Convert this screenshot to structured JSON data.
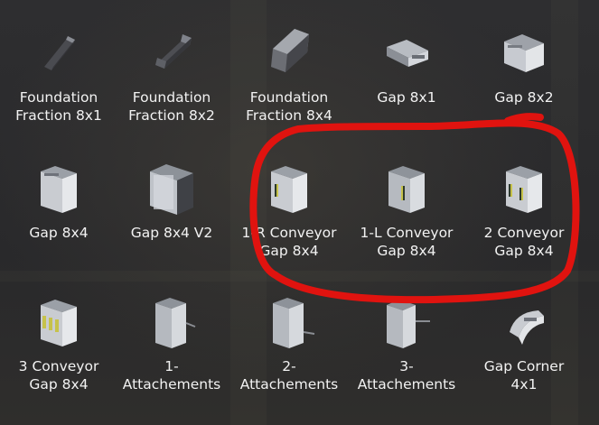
{
  "items": [
    {
      "label": "Foundation\nFraction 8x1",
      "icon": "foundation-fraction-icon"
    },
    {
      "label": "Foundation\nFraction 8x2",
      "icon": "foundation-fraction-icon"
    },
    {
      "label": "Foundation\nFraction 8x4",
      "icon": "foundation-fraction-icon"
    },
    {
      "label": "Gap 8x1",
      "icon": "gap-block-icon"
    },
    {
      "label": "Gap 8x2",
      "icon": "gap-block-icon"
    },
    {
      "label": "Gap 8x4",
      "icon": "gap-block-icon"
    },
    {
      "label": "Gap 8x4 V2",
      "icon": "gap-block-icon"
    },
    {
      "label": "1-R Conveyor\nGap 8x4",
      "icon": "conveyor-gap-icon"
    },
    {
      "label": "1-L Conveyor\nGap 8x4",
      "icon": "conveyor-gap-icon"
    },
    {
      "label": "2 Conveyor\nGap 8x4",
      "icon": "conveyor-gap-icon"
    },
    {
      "label": "3 Conveyor\nGap 8x4",
      "icon": "conveyor-gap-icon"
    },
    {
      "label": "1-\nAttachements",
      "icon": "attachment-icon"
    },
    {
      "label": "2-\nAttachements",
      "icon": "attachment-icon"
    },
    {
      "label": "3-\nAttachements",
      "icon": "attachment-icon"
    },
    {
      "label": "Gap Corner\n4x1",
      "icon": "gap-corner-icon"
    }
  ],
  "annotation": {
    "color": "#e0130f"
  }
}
